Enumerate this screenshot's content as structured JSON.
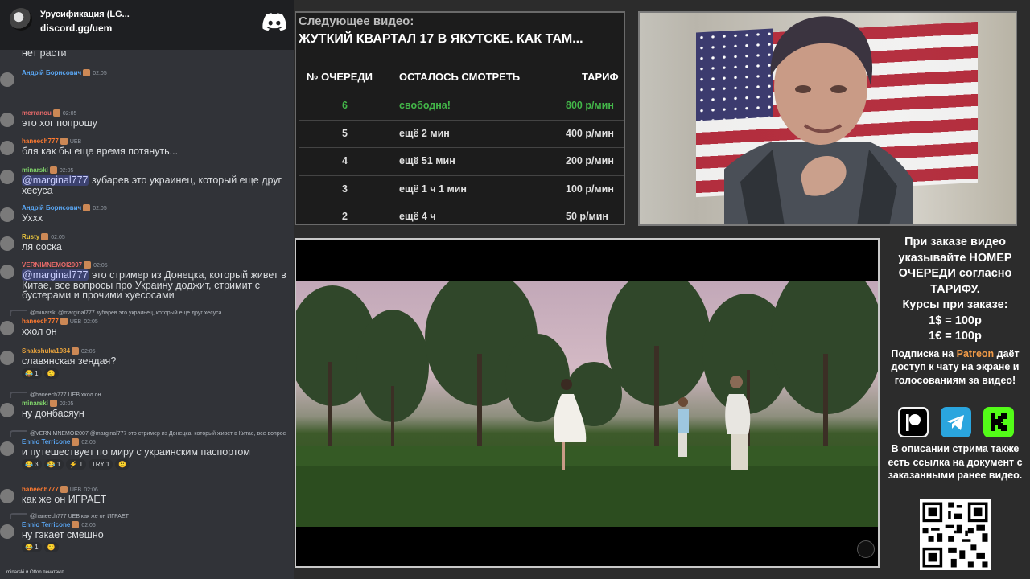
{
  "discord": {
    "server_name": "Урусификация (LG...",
    "invite": "discord.gg/uem",
    "messages": [
      {
        "type": "text",
        "text": "нет расти"
      },
      {
        "type": "message",
        "user": "Андрій Борисович",
        "color": "#5aa7f4",
        "time": "02:05",
        "text": ""
      },
      {
        "type": "message",
        "user": "merranou",
        "color": "#e86a6a",
        "time": "02:05",
        "text": "это хог попрошу"
      },
      {
        "type": "message",
        "user": "haneech777",
        "color": "#ff7a30",
        "time": "",
        "badge": "UEB",
        "text": "бля как бы еще время потянуть..."
      },
      {
        "type": "message",
        "user": "minarski",
        "color": "#7fd36a",
        "time": "02:05",
        "mention": "@marginal777",
        "text": " зубарев это украинец, который еще друг хесуса"
      },
      {
        "type": "message",
        "user": "Андрій Борисович",
        "color": "#5aa7f4",
        "time": "02:05",
        "text": "Ухxx"
      },
      {
        "type": "message",
        "user": "Rusty",
        "color": "#e8c33c",
        "time": "02:05",
        "text": "ля соска"
      },
      {
        "type": "message",
        "user": "VERNIMNEMOI2007",
        "color": "#e86a6a",
        "time": "02:05",
        "mention": "@marginal777",
        "text": " это стример из Донецка, который живет в Китае, все вопросы про Украину доджит, стримит с бустерами и прочими хуесосами"
      },
      {
        "type": "message",
        "user": "haneech777",
        "color": "#ff7a30",
        "time": "02:05",
        "badge": "UEB",
        "reply": "@minarski @marginal777 зубарев это украинец, который еще друг хесуса",
        "text": "ххол он"
      },
      {
        "type": "message",
        "user": "Shakshuka1984",
        "color": "#e8a33c",
        "time": "02:05",
        "text": "славянская зендая?",
        "reactions": [
          "😂 1",
          "🙂"
        ]
      },
      {
        "type": "message",
        "user": "minarski",
        "color": "#7fd36a",
        "time": "02:05",
        "reply": "@haneech777 UEB ххол он",
        "text": "ну донбасяун"
      },
      {
        "type": "message",
        "user": "Ennio Terricone",
        "color": "#5aa7f4",
        "time": "02:05",
        "reply": "@VERNIMNEMOI2007 @marginal777 это стример из Донецка, который живет в Китае, все вопрос",
        "text": "и путешествует по миру с украинским паспортом",
        "reactions": [
          "😂 3",
          "😂 1",
          "⚡ 1",
          "TRY 1",
          "🙂"
        ]
      },
      {
        "type": "message",
        "user": "haneech777",
        "color": "#ff7a30",
        "time": "02:06",
        "badge": "UEB",
        "text": "как же он ИГРАЕТ"
      },
      {
        "type": "message",
        "user": "Ennio Terricone",
        "color": "#5aa7f4",
        "time": "02:06",
        "reply": "@haneech777 UEB как же он ИГРАЕТ",
        "text": "ну гэкает смешно",
        "reactions": [
          "😂 1",
          "🙂"
        ]
      }
    ],
    "typing": "minarski и Otton печатают..."
  },
  "queue": {
    "next_label": "Следующее видео:",
    "next_title": "ЖУТКИЙ КВАРТАЛ 17 В ЯКУТСКЕ. КАК ТАМ...",
    "headers": [
      "№ ОЧЕРЕДИ",
      "ОСТАЛОСЬ СМОТРЕТЬ",
      "ТАРИФ"
    ],
    "rows": [
      {
        "num": "6",
        "left": "свободна!",
        "rate": "800 р/мин"
      },
      {
        "num": "5",
        "left": "ещё 2 мин",
        "rate": "400 р/мин"
      },
      {
        "num": "4",
        "left": "ещё 51 мин",
        "rate": "200 р/мин"
      },
      {
        "num": "3",
        "left": "ещё 1 ч 1 мин",
        "rate": "100 р/мин"
      },
      {
        "num": "2",
        "left": "ещё 4 ч",
        "rate": "50 р/мин"
      }
    ],
    "highlight_color": "#43b649"
  },
  "info": {
    "order_note": "При заказе видео указывайте НОМЕР ОЧЕРЕДИ согласно ТАРИФУ.",
    "rates_title": "Курсы при заказе:",
    "rate_usd": "1$ = 100р",
    "rate_eur": "1€ = 100р",
    "sub_prefix": "Подписка на ",
    "sub_link": "Patreon",
    "sub_suffix": " даёт доступ к чату на экране и голосованиям за видео!",
    "description_note": "В описании стрима также есть ссылка на документ с заказанными ранее видео."
  }
}
